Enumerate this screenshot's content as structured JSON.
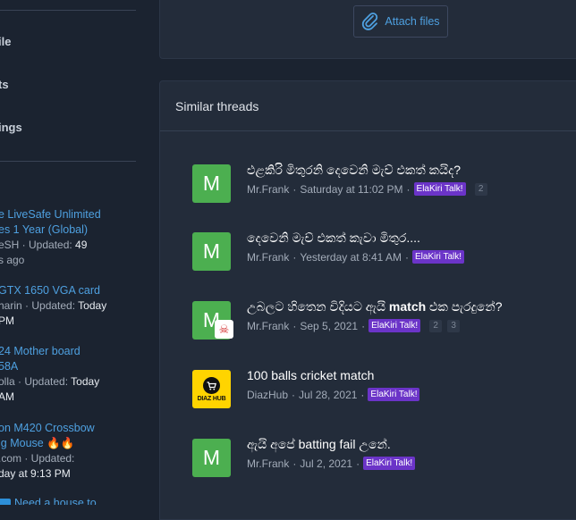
{
  "sidebar": {
    "links": [
      "ile",
      "ts",
      "ings"
    ],
    "threads": [
      {
        "title_lines": [
          "e LiveSafe Unlimited",
          "es 1 Year (Global)"
        ],
        "meta_lines": [
          {
            "prefix": "eSH · Updated: ",
            "bold": "49"
          },
          {
            "prefix": "s ago",
            "bold": ""
          }
        ]
      },
      {
        "title_lines": [
          "GTX 1650 VGA card"
        ],
        "meta_lines": [
          {
            "prefix": "harin · Updated: ",
            "bold": "Today"
          },
          {
            "prefix": "",
            "bold": "PM"
          }
        ]
      },
      {
        "title_lines": [
          " 24 Mother board",
          "58A"
        ],
        "meta_lines": [
          {
            "prefix": "olla · Updated: ",
            "bold": "Today"
          },
          {
            "prefix": "",
            "bold": "AM"
          }
        ]
      },
      {
        "title_lines": [
          "on M420 Crossbow",
          "ig Mouse 🔥🔥"
        ],
        "meta_lines": [
          {
            "prefix": ".com · Updated: ",
            "bold": ""
          },
          {
            "prefix": "",
            "bold": "day at 9:13 PM"
          }
        ]
      },
      {
        "title_lines": [
          "Need a house to"
        ],
        "meta_lines": []
      }
    ]
  },
  "attach": {
    "label": "Attach files",
    "icon": "paperclip-icon",
    "color": "#4ea0e0"
  },
  "similar": {
    "heading": "Similar threads",
    "threads": [
      {
        "avatar": "M",
        "title_pre": "එළකිරි මිතුරනි දෙවෙනි මැච් එකත් කයිද?",
        "title_bold": "",
        "title_post": "",
        "author": "Mr.Frank",
        "date": "Saturday at 11:02 PM",
        "forum": "ElaKiri Talk!",
        "pages": [
          "2"
        ]
      },
      {
        "avatar": "M",
        "title_pre": "දෙවෙනි මැච් එකත් කැවා මිතුර....",
        "title_bold": "",
        "title_post": "",
        "author": "Mr.Frank",
        "date": "Yesterday at 8:41 AM",
        "forum": "ElaKiri Talk!",
        "pages": []
      },
      {
        "avatar": "M",
        "title_pre": "උබලට හිතෙන විදියට ඇයි ",
        "title_bold": "match",
        "title_post": " එක පැරදුනේ?",
        "author": "Mr.Frank",
        "date": "Sep 5, 2021",
        "forum": "ElaKiri Talk!",
        "pages": [
          "2",
          "3"
        ]
      },
      {
        "avatar": "DIAZ HUB",
        "title_pre": "100 balls cricket match",
        "title_bold": "",
        "title_post": "",
        "author": "DiazHub",
        "date": "Jul 28, 2021",
        "forum": "ElaKiri Talk!",
        "pages": []
      },
      {
        "avatar": "M",
        "title_pre": "ඇයි අපේ batting fail උනේ.",
        "title_bold": "",
        "title_post": "",
        "author": "Mr.Frank",
        "date": "Jul 2, 2021",
        "forum": "ElaKiri Talk!",
        "pages": []
      }
    ]
  }
}
